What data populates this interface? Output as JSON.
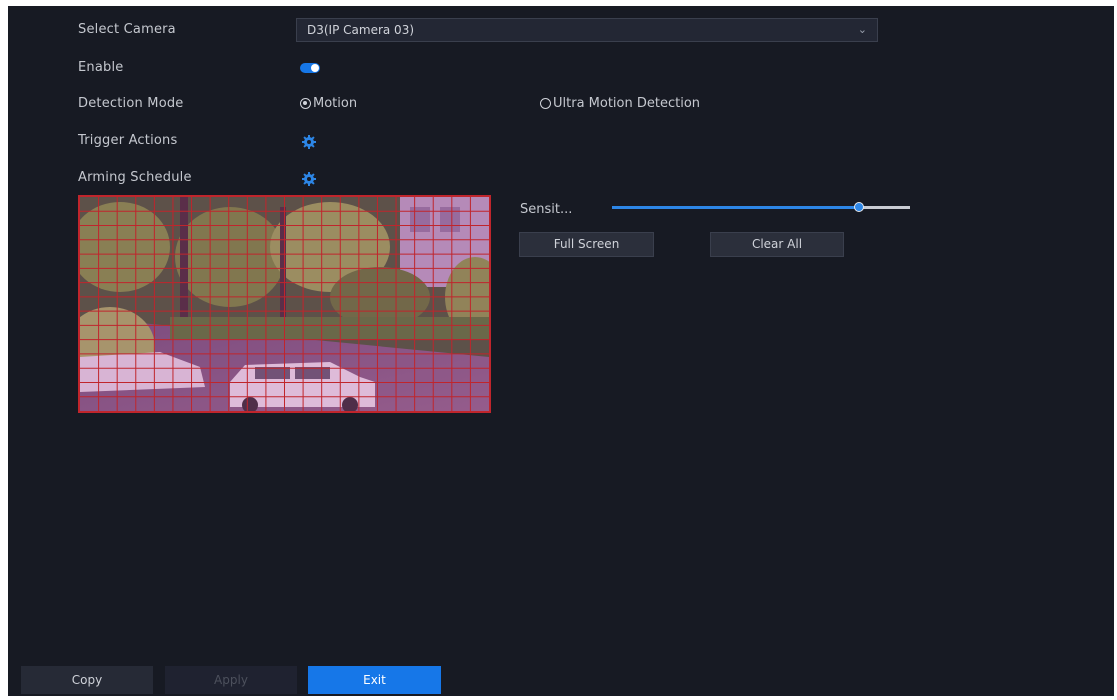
{
  "form": {
    "select_camera_label": "Select Camera",
    "camera_value": "D3(IP Camera 03)",
    "enable_label": "Enable",
    "enabled": true,
    "detection_mode_label": "Detection Mode",
    "mode_options": [
      "Motion",
      "Ultra Motion Detection"
    ],
    "selected_mode": "Motion",
    "trigger_actions_label": "Trigger Actions",
    "arming_schedule_label": "Arming Schedule"
  },
  "controls": {
    "sensitivity_label": "Sensit...",
    "sensitivity_level": 0.83,
    "full_screen_label": "Full Screen",
    "clear_all_label": "Clear All"
  },
  "footer": {
    "copy_label": "Copy",
    "apply_label": "Apply",
    "exit_label": "Exit"
  },
  "colors": {
    "accent": "#1677e8",
    "detection_grid": "#c0252c",
    "background": "#171a23"
  },
  "icons": {
    "trigger_actions": "gear-icon",
    "arming_schedule": "gear-icon",
    "dropdown": "chevron-down-icon"
  }
}
